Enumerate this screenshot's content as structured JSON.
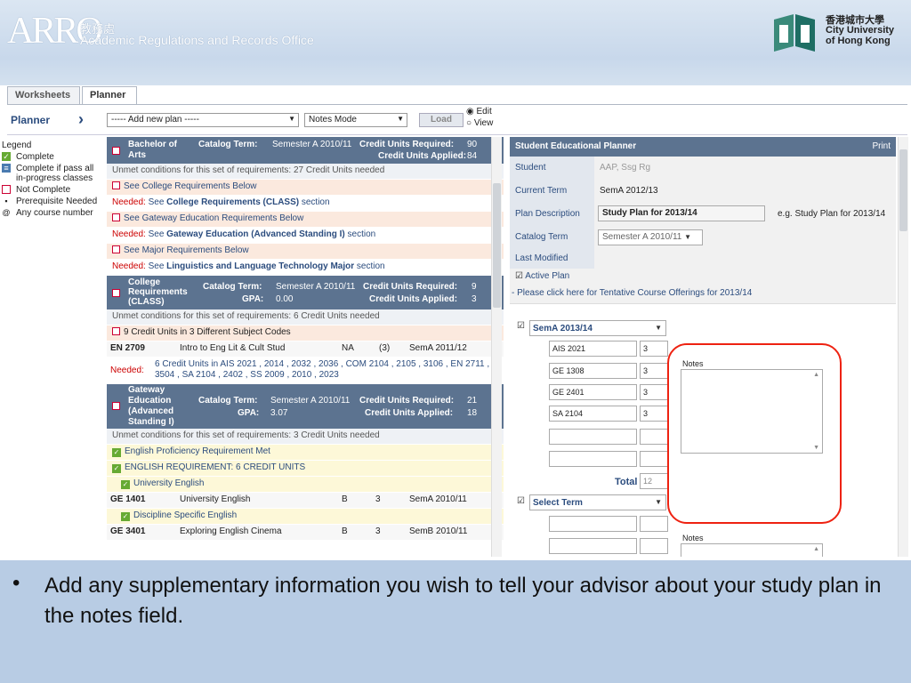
{
  "banner": {
    "arro_logo": "ARRO",
    "arro_cn": "教務處",
    "arro_en": "Academic Regulations and Records Office",
    "cityu_cn": "香港城市大學",
    "cityu_en": "City University of Hong Kong"
  },
  "tabs": [
    "Worksheets",
    "Planner"
  ],
  "toolbar": {
    "planner_label": "Planner",
    "add_plan": "----- Add new plan -----",
    "mode": "Notes Mode",
    "load": "Load",
    "edit": "Edit",
    "view": "View"
  },
  "legend": {
    "title": "Legend",
    "items": [
      {
        "label": "Complete",
        "icon": "check-icon"
      },
      {
        "label": "Complete if pass all in-progress classes",
        "icon": "minus-icon"
      },
      {
        "label": "Not Complete",
        "icon": "box-icon"
      },
      {
        "label": "Prerequisite Needed",
        "icon": "dot-icon"
      },
      {
        "label": "Any course number",
        "icon": "at-icon"
      }
    ]
  },
  "left": {
    "arts": {
      "name": "Bachelor of Arts",
      "catalog_label": "Catalog Term:",
      "catalog": "Semester A 2010/11",
      "cu_req_label": "Credit Units Required:",
      "cu_req": "90",
      "cu_app_label": "Credit Units Applied:",
      "cu_app": "84"
    },
    "unmet1": "Unmet conditions for this set of requirements:",
    "unmet1_val": "27 Credit Units needed",
    "r1": "See College Requirements Below",
    "n1a": "Needed:",
    "n1b": "See",
    "n1c": "College Requirements (CLASS)",
    "n1d": "section",
    "r2": "See Gateway Education Requirements Below",
    "n2c": "Gateway Education (Advanced Standing I)",
    "n2d": "section",
    "r3": "See Major Requirements Below",
    "n3c": "Linguistics and Language Technology Major",
    "n3d": "section",
    "class": {
      "name": "College Requirements (CLASS)",
      "catalog": "Semester A 2010/11",
      "cu_req": "9",
      "gpa_label": "GPA:",
      "gpa": "0.00",
      "cu_app": "3"
    },
    "unmet2_val": "6 Credit Units needed",
    "r4": "9 Credit Units in 3 Different Subject Codes",
    "en2709": {
      "code": "EN 2709",
      "title": "Intro to Eng Lit & Cult Stud",
      "grade": "NA",
      "units": "(3)",
      "term": "SemA 2011/12"
    },
    "need4": "6 Credit Units in AIS 2021 , 2014 , 2032 , 2036 , COM 2104 , 2105 , 3106 , EN 2711 , 3504 , SA 2104 , 2402 , SS 2009 , 2010 , 2023",
    "gate": {
      "name": "Gateway Education (Advanced Standing I)",
      "catalog": "Semester A 2010/11",
      "cu_req": "21",
      "gpa": "3.07",
      "cu_app": "18"
    },
    "unmet3_val": "3 Credit Units needed",
    "c1": "English Proficiency Requirement Met",
    "c2": "ENGLISH REQUIREMENT: 6 CREDIT UNITS",
    "c3": "University English",
    "ge1401": {
      "code": "GE 1401",
      "title": "University English",
      "grade": "B",
      "units": "3",
      "term": "SemA 2010/11"
    },
    "c4": "Discipline Specific English",
    "ge3401": {
      "code": "GE 3401",
      "title": "Exploring English Cinema",
      "grade": "B",
      "units": "3",
      "term": "SemB 2010/11"
    }
  },
  "right": {
    "title": "Student Educational Planner",
    "print": "Print",
    "student_label": "Student",
    "student_val": "AAP, Ssg Rg",
    "term_label": "Current Term",
    "term_val": "SemA 2012/13",
    "desc_label": "Plan Description",
    "desc_val": "Study Plan for 2013/14",
    "desc_hint": "e.g. Study Plan for 2013/14",
    "cat_label": "Catalog Term",
    "cat_val": "Semester A 2010/11",
    "mod_label": "Last Modified",
    "active": "Active Plan",
    "link": "- Please click here for Tentative Course Offerings for 2013/14",
    "sem": "SemA 2013/14",
    "courses": [
      {
        "code": "AIS 2021",
        "units": "3"
      },
      {
        "code": "GE 1308",
        "units": "3"
      },
      {
        "code": "GE 2401",
        "units": "3"
      },
      {
        "code": "SA 2104",
        "units": "3"
      }
    ],
    "total_label": "Total",
    "total": "12",
    "notes": "Notes",
    "sel_term": "Select Term"
  },
  "caption": {
    "bullet": "•",
    "text": "Add any supplementary information you wish to tell your advisor about your study plan in the notes field."
  }
}
